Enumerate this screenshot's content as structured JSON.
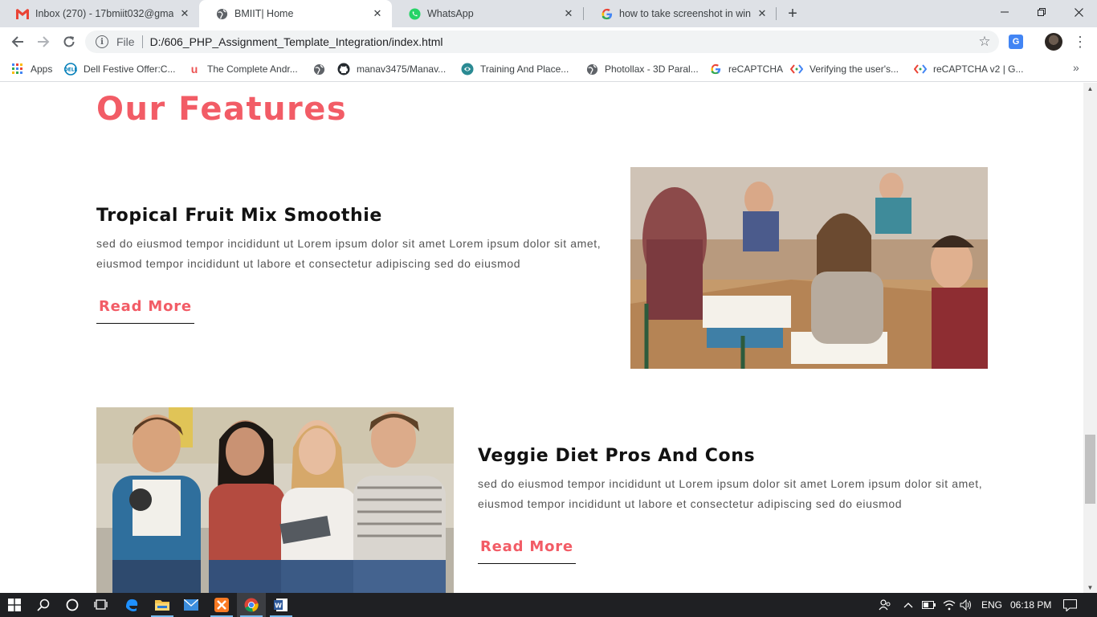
{
  "browser": {
    "tabs": [
      {
        "title": "Inbox (270) - 17bmiit032@gmail.",
        "icon": "gmail-icon",
        "active": false
      },
      {
        "title": "BMIIT| Home",
        "icon": "globe-icon",
        "active": true
      },
      {
        "title": "WhatsApp",
        "icon": "whatsapp-icon",
        "active": false
      },
      {
        "title": "how to take screenshot in windo",
        "icon": "google-icon",
        "active": false
      }
    ],
    "new_tab_label": "+",
    "address": {
      "scheme_label": "File",
      "url": "D:/606_PHP_Assignment_Template_Integration/index.html"
    },
    "bookmarks": [
      {
        "label": "Apps",
        "icon": "apps-grid-icon"
      },
      {
        "label": "Dell Festive Offer:C...",
        "icon": "dell-icon"
      },
      {
        "label": "The Complete Andr...",
        "icon": "udemy-icon"
      },
      {
        "label": "",
        "icon": "globe-icon"
      },
      {
        "label": "manav3475/Manav...",
        "icon": "github-icon"
      },
      {
        "label": "Training And Place...",
        "icon": "training-icon"
      },
      {
        "label": "Photollax - 3D Paral...",
        "icon": "globe-icon"
      },
      {
        "label": "reCAPTCHA",
        "icon": "google-icon"
      },
      {
        "label": "Verifying the user's...",
        "icon": "code-icon"
      },
      {
        "label": "reCAPTCHA v2  |  G...",
        "icon": "code-icon"
      }
    ],
    "bookmarks_more": "»"
  },
  "page": {
    "section_title": "Our Features",
    "features": [
      {
        "title": "Tropical Fruit Mix Smoothie",
        "text": "sed do eiusmod tempor incididunt ut Lorem ipsum dolor sit amet Lorem ipsum dolor sit amet, eiusmod tempor incididunt ut labore et consectetur adipiscing sed do eiusmod",
        "button": "Read More",
        "image": "students-classroom-photo"
      },
      {
        "title": "Veggie Diet Pros And Cons",
        "text": "sed do eiusmod tempor incididunt ut Lorem ipsum dolor sit amet Lorem ipsum dolor sit amet, eiusmod tempor incididunt ut labore et consectetur adipiscing sed do eiusmod",
        "button": "Read More",
        "image": "students-group-photo"
      }
    ]
  },
  "taskbar": {
    "language": "ENG",
    "time": "06:18 PM",
    "apps": [
      "start-icon",
      "search-icon",
      "cortana-icon",
      "task-view-icon",
      "edge-icon",
      "file-explorer-icon",
      "mail-icon",
      "xampp-icon",
      "chrome-icon",
      "word-icon"
    ]
  },
  "colors": {
    "accent": "#f25c66",
    "heading": "#111111",
    "body_text": "#555555"
  }
}
